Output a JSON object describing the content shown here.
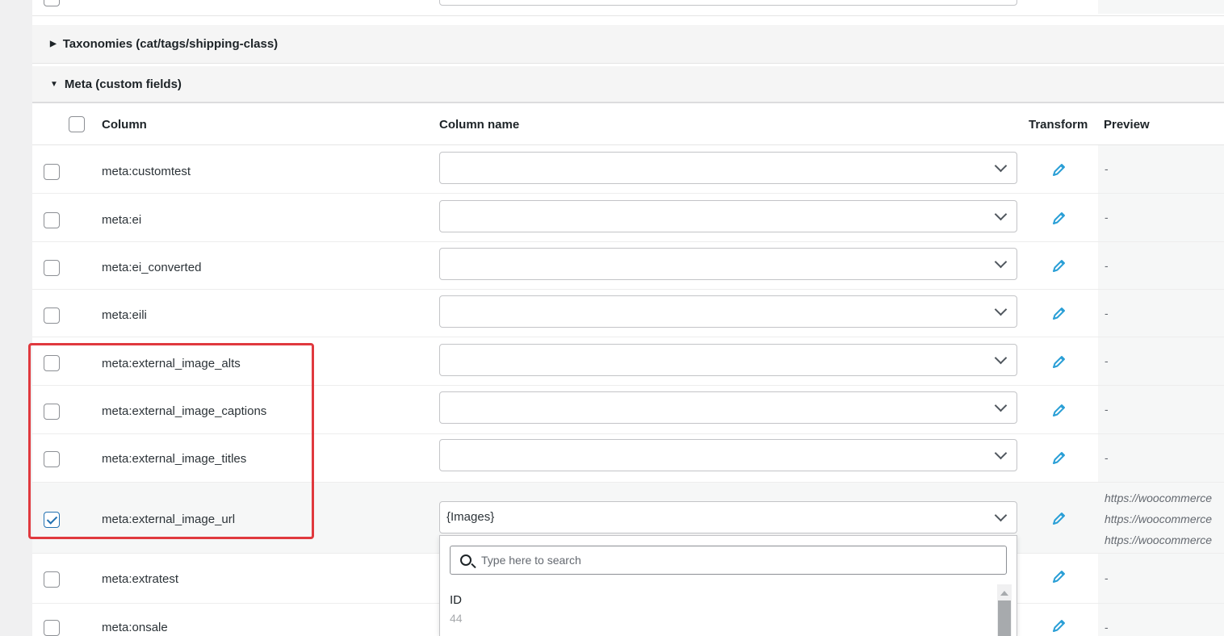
{
  "sections": {
    "taxonomies": "Taxonomies (cat/tags/shipping-class)",
    "meta": "Meta (custom fields)"
  },
  "table": {
    "headers": {
      "column": "Column",
      "column_name": "Column name",
      "transform": "Transform",
      "preview": "Preview"
    }
  },
  "rows": [
    {
      "column": "meta:customtest",
      "value": "",
      "checked": false,
      "preview": "-"
    },
    {
      "column": "meta:ei",
      "value": "",
      "checked": false,
      "preview": "-"
    },
    {
      "column": "meta:ei_converted",
      "value": "",
      "checked": false,
      "preview": "-"
    },
    {
      "column": "meta:eili",
      "value": "",
      "checked": false,
      "preview": "-"
    },
    {
      "column": "meta:external_image_alts",
      "value": "",
      "checked": false,
      "preview": "-"
    },
    {
      "column": "meta:external_image_captions",
      "value": "",
      "checked": false,
      "preview": "-"
    },
    {
      "column": "meta:external_image_titles",
      "value": "",
      "checked": false,
      "preview": "-"
    },
    {
      "column": "meta:external_image_url",
      "value": "{Images}",
      "checked": true,
      "preview": [
        "https://woocommerce",
        "https://woocommerce",
        "https://woocommerce"
      ]
    },
    {
      "column": "meta:extratest",
      "value": "",
      "checked": false,
      "preview": "-"
    },
    {
      "column": "meta:onsale",
      "value": "",
      "checked": false,
      "preview": "-"
    }
  ],
  "dropdown": {
    "search_placeholder": "Type here to search",
    "option_label": "ID",
    "option_value": "44"
  },
  "colors": {
    "accent": "#2271b1",
    "highlight": "#e0393e",
    "pencil": "#2a9fd6"
  }
}
